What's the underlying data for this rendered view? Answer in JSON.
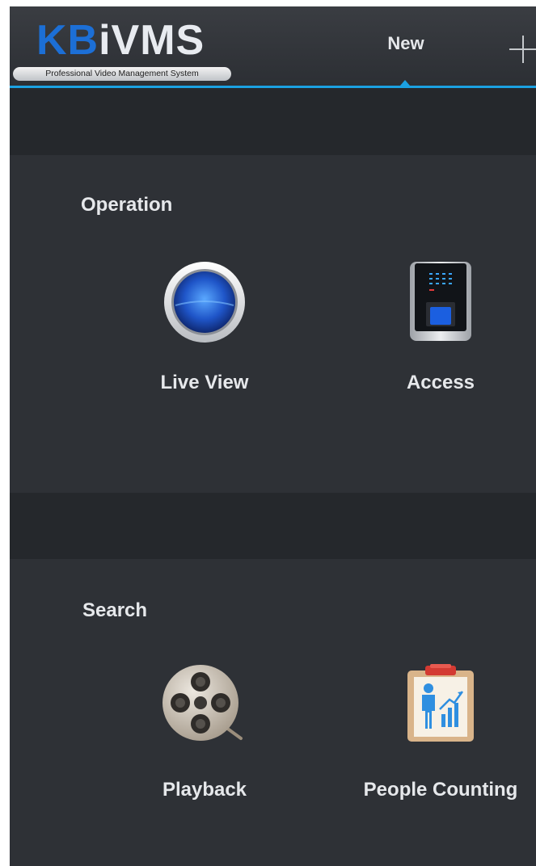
{
  "header": {
    "logo_kb": "KB",
    "logo_ivms": "iVMS",
    "logo_subtitle": "Professional Video Management System",
    "active_tab": "New",
    "add_tab_icon": "plus-icon"
  },
  "sections": [
    {
      "title": "Operation",
      "items": [
        {
          "label": "Live View",
          "icon": "live-view-icon"
        },
        {
          "label": "Access",
          "icon": "access-control-icon"
        }
      ]
    },
    {
      "title": "Search",
      "items": [
        {
          "label": "Playback",
          "icon": "film-reel-icon"
        },
        {
          "label": "People Counting",
          "icon": "people-counting-icon"
        }
      ]
    }
  ],
  "colors": {
    "accent": "#1ba1e2",
    "background": "#2e3136",
    "header": "#33363b",
    "text": "#e6e8eb",
    "logo_blue": "#1c6fd6"
  }
}
